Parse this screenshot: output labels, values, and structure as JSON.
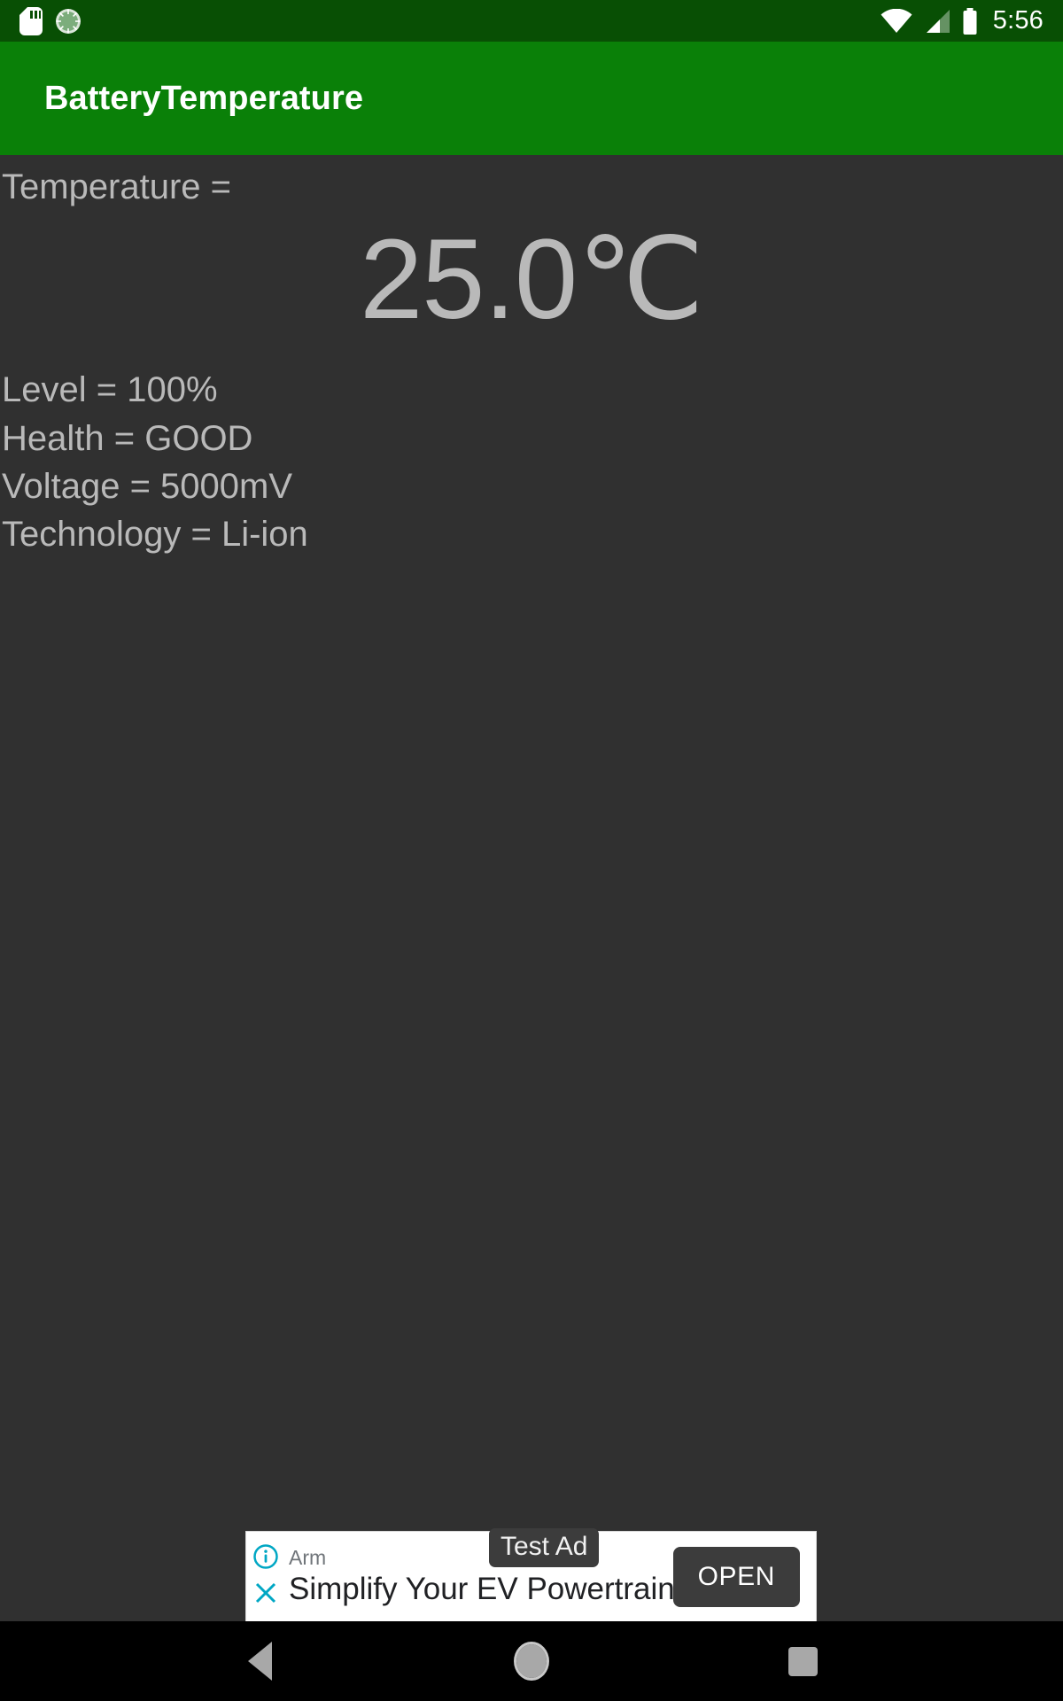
{
  "status_bar": {
    "icons_left": [
      "sd-card-icon",
      "sync-badge-icon"
    ],
    "icons_right": [
      "wifi-icon",
      "cellular-signal-icon",
      "battery-icon"
    ],
    "time": "5:56",
    "background_color": "#084F04"
  },
  "action_bar": {
    "title": "BatteryTemperature",
    "background_color": "#0A8008",
    "text_color": "#FFFFFF"
  },
  "main": {
    "temperature_label": "Temperature =",
    "temperature_value": "25.0℃",
    "details": [
      "Level = 100%",
      "Health = GOOD",
      "Voltage = 5000mV",
      "Technology = Li-ion"
    ],
    "background_color": "#303030",
    "text_color": "#B9B9B9"
  },
  "ad": {
    "badge": "Test Ad",
    "advertiser": "Arm",
    "headline": "Simplify Your EV Powertrain",
    "cta_label": "OPEN",
    "info_icon": "info-circle-icon",
    "close_icon": "close-x-icon",
    "accent_color": "#00A7C4",
    "cta_color": "#3C3C3C"
  },
  "nav_bar": {
    "back": "back-triangle-icon",
    "home": "home-circle-icon",
    "recents": "recents-square-icon",
    "background_color": "#000000"
  }
}
